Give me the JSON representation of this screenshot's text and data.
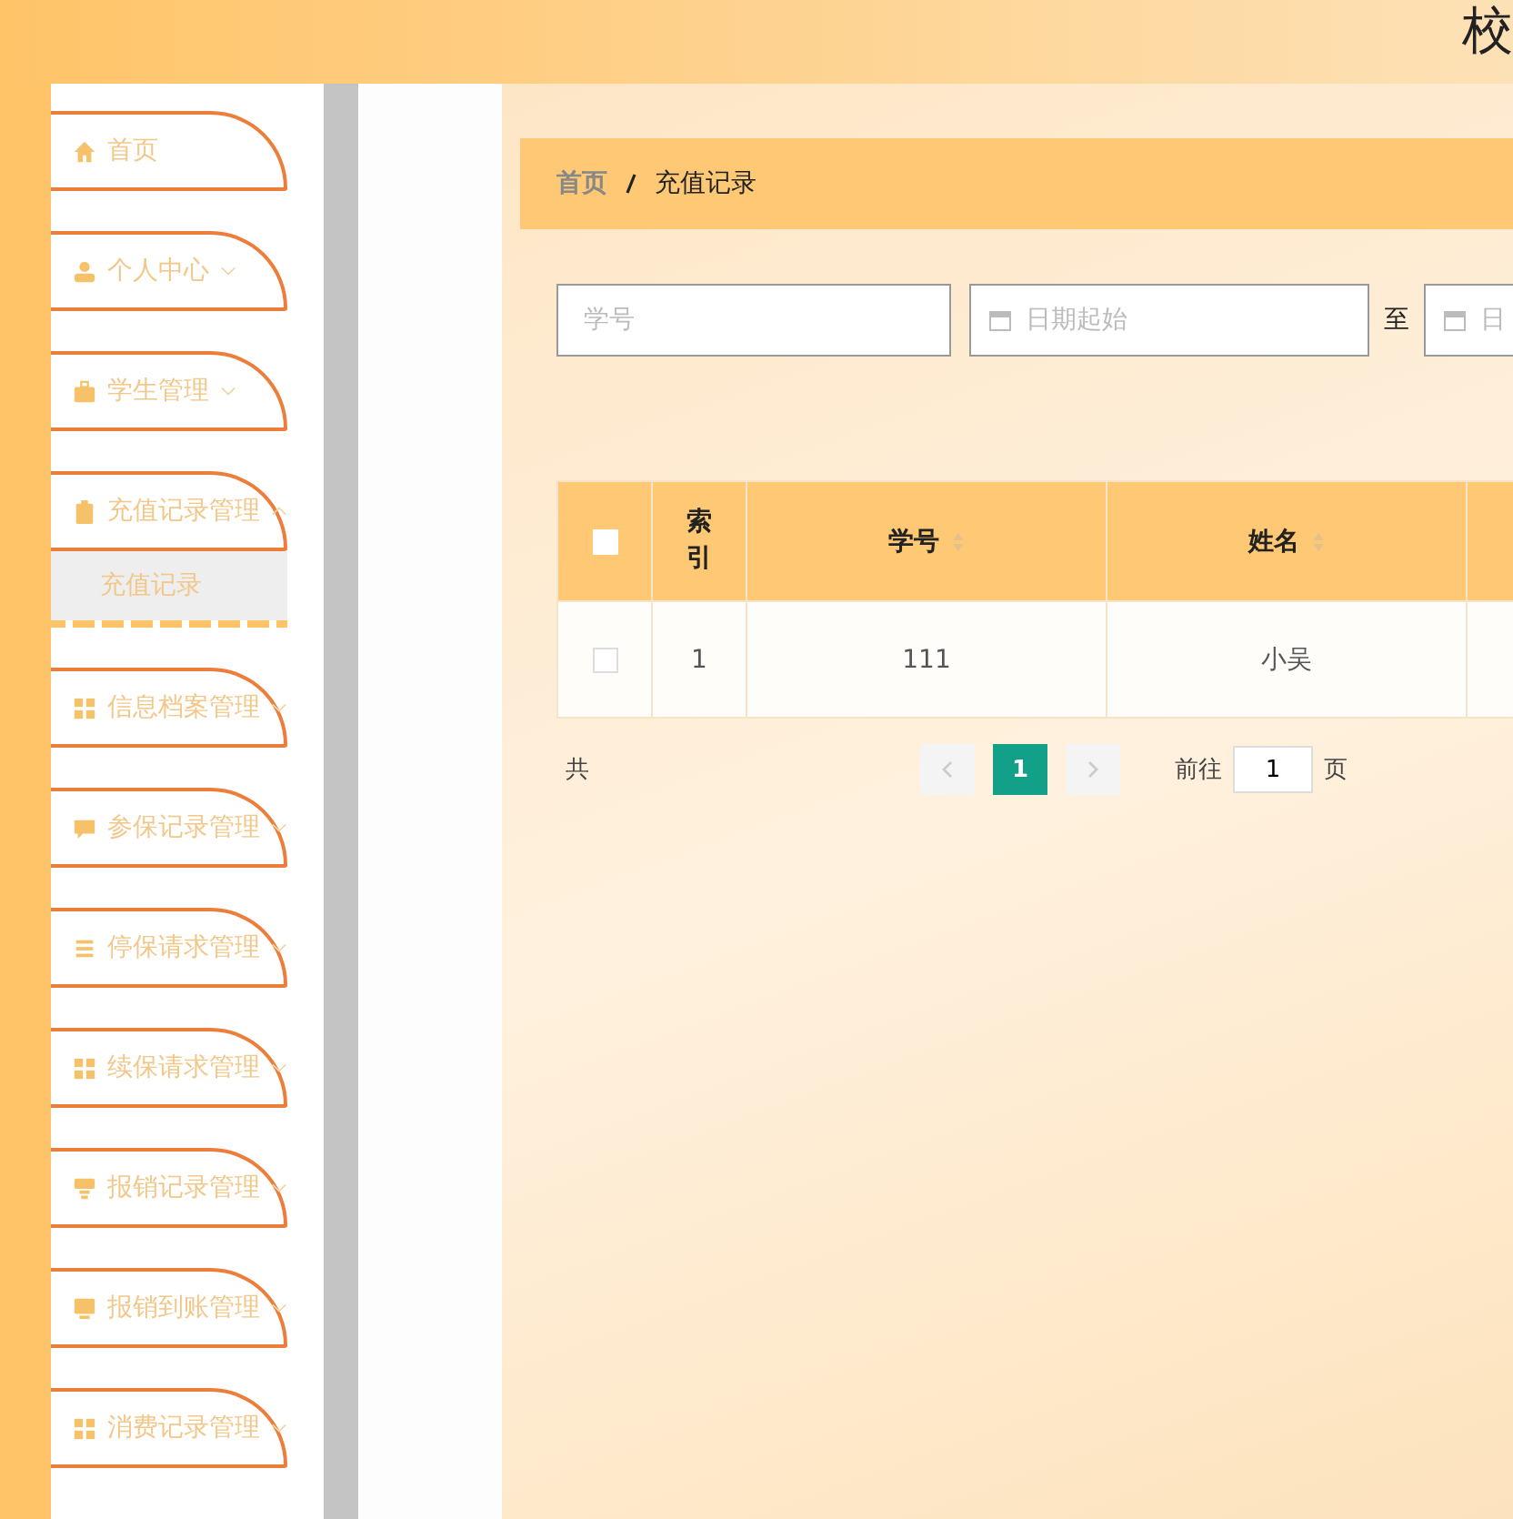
{
  "header": {
    "title": "校"
  },
  "sidebar": {
    "items": [
      {
        "label": "首页",
        "has_submenu": false,
        "expanded": false
      },
      {
        "label": "个人中心",
        "has_submenu": true,
        "expanded": false
      },
      {
        "label": "学生管理",
        "has_submenu": true,
        "expanded": false
      },
      {
        "label": "充值记录管理",
        "has_submenu": true,
        "expanded": true,
        "children": [
          {
            "label": "充值记录",
            "selected": true
          }
        ]
      },
      {
        "label": "信息档案管理",
        "has_submenu": true,
        "expanded": false
      },
      {
        "label": "参保记录管理",
        "has_submenu": true,
        "expanded": false
      },
      {
        "label": "停保请求管理",
        "has_submenu": true,
        "expanded": false
      },
      {
        "label": "续保请求管理",
        "has_submenu": true,
        "expanded": false
      },
      {
        "label": "报销记录管理",
        "has_submenu": true,
        "expanded": false
      },
      {
        "label": "报销到账管理",
        "has_submenu": true,
        "expanded": false
      },
      {
        "label": "消费记录管理",
        "has_submenu": true,
        "expanded": false
      }
    ]
  },
  "breadcrumb": [
    "首页",
    "充值记录"
  ],
  "search": {
    "student_id": {
      "placeholder": "学号"
    },
    "date_start": {
      "placeholder": "日期起始"
    },
    "separator": "至",
    "date_end": {
      "placeholder": "日"
    }
  },
  "table": {
    "columns": [
      {
        "label": "索引"
      },
      {
        "label": "学号",
        "sortable": true
      },
      {
        "label": "姓名",
        "sortable": true
      }
    ],
    "header_checked": false,
    "rows": [
      {
        "checked": false,
        "cells": [
          "1",
          "111",
          "小吴"
        ]
      }
    ]
  },
  "pagination": {
    "total_prefix": "共",
    "pages": [
      {
        "label": "1",
        "selected": true
      }
    ],
    "goto_label": "前往",
    "goto_value": "1",
    "goto_suffix": "页"
  }
}
